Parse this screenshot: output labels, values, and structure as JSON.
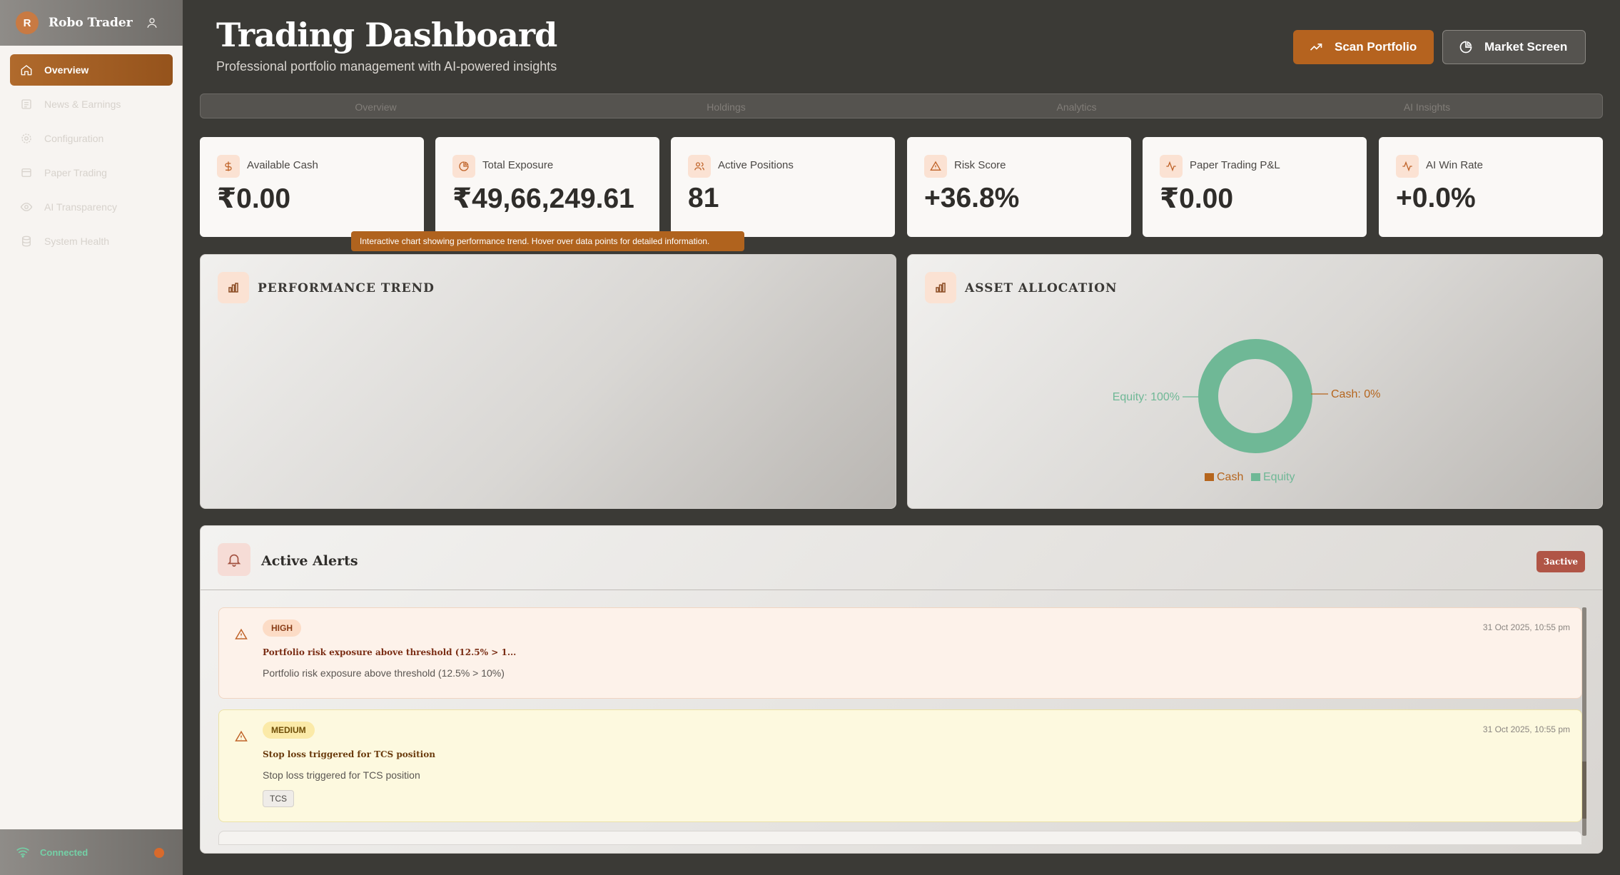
{
  "app": {
    "avatar_letter": "R",
    "name": "Robo Trader"
  },
  "sidebar": {
    "items": [
      {
        "label": "Overview",
        "icon": "home-icon",
        "active": true
      },
      {
        "label": "News & Earnings",
        "icon": "newspaper-icon",
        "active": false
      },
      {
        "label": "Configuration",
        "icon": "gear-icon",
        "active": false
      },
      {
        "label": "Paper Trading",
        "icon": "document-icon",
        "active": false
      },
      {
        "label": "AI Transparency",
        "icon": "eye-icon",
        "active": false
      },
      {
        "label": "System Health",
        "icon": "database-icon",
        "active": false
      }
    ],
    "status": "Connected"
  },
  "header": {
    "title": "Trading Dashboard",
    "subtitle": "Professional portfolio management with AI-powered insights",
    "scan_label": "Scan Portfolio",
    "market_label": "Market Screen"
  },
  "tabs": [
    "Overview",
    "Holdings",
    "Analytics",
    "AI Insights"
  ],
  "stats": [
    {
      "label": "Available Cash",
      "value": "₹0.00",
      "icon": "dollar-icon"
    },
    {
      "label": "Total Exposure",
      "value": "₹49,66,249.61",
      "icon": "pie-icon"
    },
    {
      "label": "Active Positions",
      "value": "81",
      "icon": "users-icon"
    },
    {
      "label": "Risk Score",
      "value": "+36.8%",
      "icon": "warning-icon"
    },
    {
      "label": "Paper Trading P&L",
      "value": "₹0.00",
      "icon": "activity-icon"
    },
    {
      "label": "AI Win Rate",
      "value": "+0.0%",
      "icon": "activity-icon"
    }
  ],
  "tooltip": "Interactive chart showing performance trend. Hover over data points for detailed information.",
  "panels": {
    "performance_title": "PERFORMANCE TREND",
    "allocation_title": "ASSET ALLOCATION"
  },
  "chart_data": {
    "type": "pie",
    "categories": [
      "Cash",
      "Equity"
    ],
    "values": [
      0,
      100
    ],
    "slice_labels": [
      "Cash: 0%",
      "Equity: 100%"
    ],
    "legend": "bottom",
    "colors": [
      "#b5651d",
      "#6fb896"
    ]
  },
  "alerts": {
    "title": "Active Alerts",
    "active_count_label": "3active",
    "items": [
      {
        "severity": "HIGH",
        "time": "31 Oct 2025, 10:55 pm",
        "title": "Portfolio risk exposure above threshold (12.5% > 1...",
        "message": "Portfolio risk exposure above threshold (12.5% > 10%)"
      },
      {
        "severity": "MEDIUM",
        "time": "31 Oct 2025, 10:55 pm",
        "title": "Stop loss triggered for TCS position",
        "message": "Stop loss triggered for TCS position",
        "tag": "TCS"
      }
    ]
  },
  "colors": {
    "accent": "#b5631f",
    "background": "#3b3a36",
    "equity": "#6fb896",
    "cash": "#b5651d"
  }
}
